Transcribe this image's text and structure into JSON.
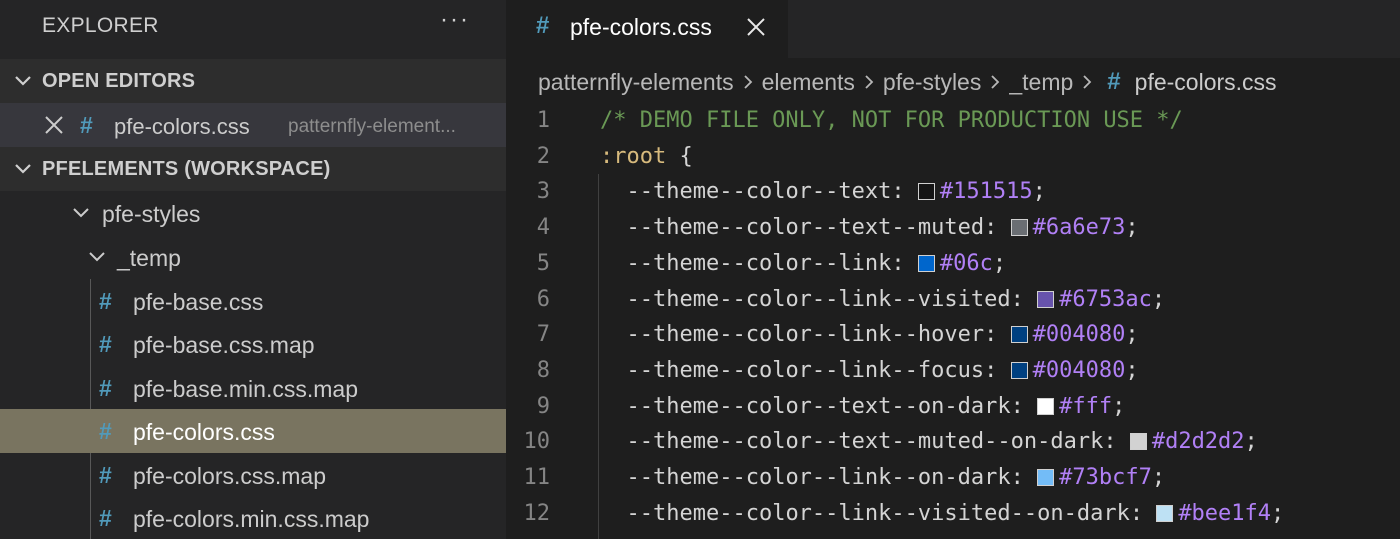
{
  "sidebar": {
    "explorer_title": "EXPLORER",
    "more_actions": "···",
    "open_editors": {
      "title": "OPEN EDITORS",
      "item": {
        "name": "pfe-colors.css",
        "path": "patternfly-element..."
      }
    },
    "workspace": {
      "title": "PFELEMENTS (WORKSPACE)",
      "folders": [
        "pfe-styles",
        "_temp"
      ],
      "files": [
        "pfe-base.css",
        "pfe-base.css.map",
        "pfe-base.min.css.map",
        "pfe-colors.css",
        "pfe-colors.css.map",
        "pfe-colors.min.css.map"
      ],
      "selected_file": "pfe-colors.css"
    }
  },
  "editor": {
    "tab": {
      "label": "pfe-colors.css",
      "icon": "css-hash-icon"
    },
    "breadcrumb": [
      "patternfly-elements",
      "elements",
      "pfe-styles",
      "_temp",
      "pfe-colors.css"
    ],
    "lines": [
      {
        "num": "1",
        "type": "comment",
        "text": "/* DEMO FILE ONLY, NOT FOR PRODUCTION USE */"
      },
      {
        "num": "2",
        "type": "selector",
        "selector": ":root",
        "brace": " {"
      },
      {
        "num": "3",
        "type": "decl",
        "prop": "--theme--color--text:",
        "value": "#151515",
        "swatch": "#151515"
      },
      {
        "num": "4",
        "type": "decl",
        "prop": "--theme--color--text--muted:",
        "value": "#6a6e73",
        "swatch": "#6a6e73"
      },
      {
        "num": "5",
        "type": "decl",
        "prop": "--theme--color--link:",
        "value": "#06c",
        "swatch": "#0066cc"
      },
      {
        "num": "6",
        "type": "decl",
        "prop": "--theme--color--link--visited:",
        "value": "#6753ac",
        "swatch": "#6753ac"
      },
      {
        "num": "7",
        "type": "decl",
        "prop": "--theme--color--link--hover:",
        "value": "#004080",
        "swatch": "#004080"
      },
      {
        "num": "8",
        "type": "decl",
        "prop": "--theme--color--link--focus:",
        "value": "#004080",
        "swatch": "#004080"
      },
      {
        "num": "9",
        "type": "decl",
        "prop": "--theme--color--text--on-dark:",
        "value": "#fff",
        "swatch": "#ffffff"
      },
      {
        "num": "10",
        "type": "decl",
        "prop": "--theme--color--text--muted--on-dark:",
        "value": "#d2d2d2",
        "swatch": "#d2d2d2"
      },
      {
        "num": "11",
        "type": "decl",
        "prop": "--theme--color--link--on-dark:",
        "value": "#73bcf7",
        "swatch": "#73bcf7"
      },
      {
        "num": "12",
        "type": "decl",
        "prop": "--theme--color--link--visited--on-dark:",
        "value": "#bee1f4",
        "swatch": "#bee1f4"
      }
    ]
  },
  "colors": {
    "sidebar_bg": "#252526",
    "editor_bg": "#1e1e1e",
    "selection_bg": "#797460",
    "css_icon": "#519aba",
    "value_color": "#b180f6",
    "comment_color": "#6a9955",
    "selector_color": "#d7ba7d"
  }
}
